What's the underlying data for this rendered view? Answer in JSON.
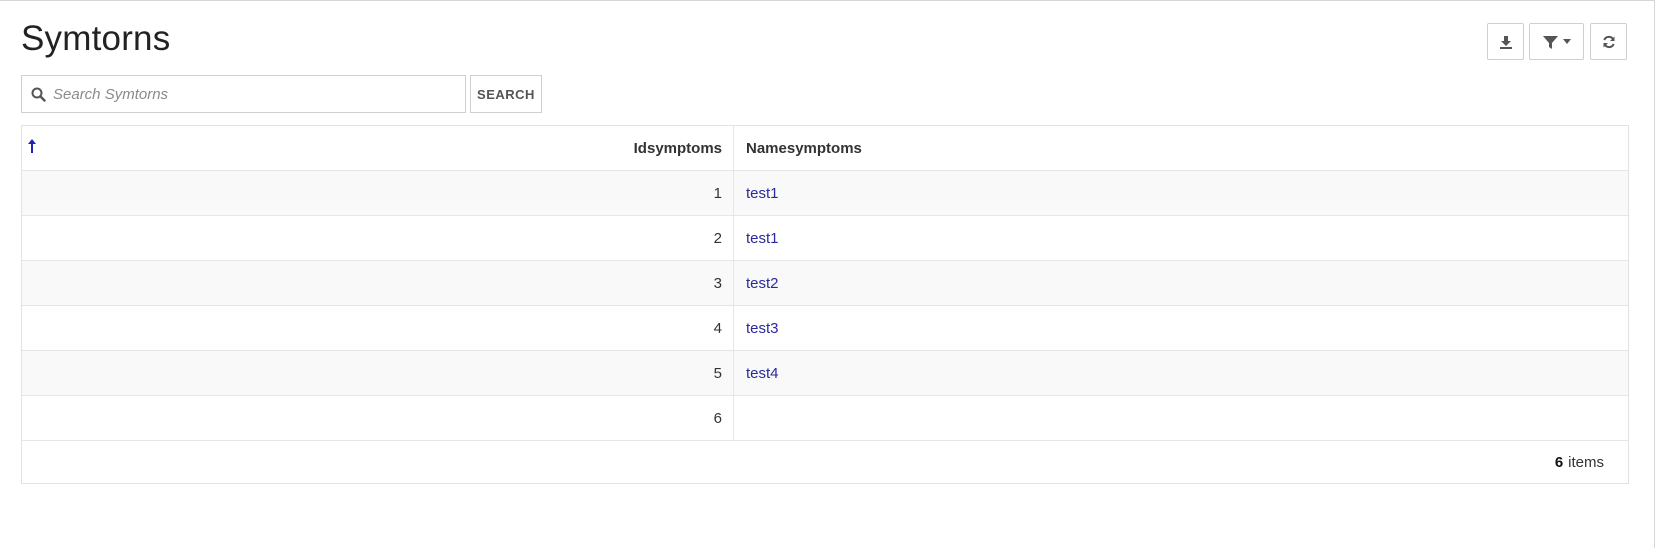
{
  "page": {
    "title": "Symtorns"
  },
  "toolbar": {
    "download_icon": "download-icon",
    "filter_icon": "filter-icon",
    "refresh_icon": "refresh-icon"
  },
  "search": {
    "placeholder": "Search Symtorns",
    "value": "",
    "button_label": "SEARCH"
  },
  "table": {
    "columns": [
      "Idsymptoms",
      "Namesymptoms"
    ],
    "sort_icon": "sort-ascending-arrow-icon",
    "rows": [
      {
        "id": "1",
        "name": "test1"
      },
      {
        "id": "2",
        "name": "test1"
      },
      {
        "id": "3",
        "name": "test2"
      },
      {
        "id": "4",
        "name": "test3"
      },
      {
        "id": "5",
        "name": "test4"
      },
      {
        "id": "6",
        "name": ""
      }
    ],
    "footer": {
      "count": "6",
      "label": "items"
    }
  },
  "colors": {
    "link": "#2a2a9c",
    "sort_arrow": "#2323b8",
    "row_alt": "#f9f9f9",
    "border": "#e2e2e2"
  }
}
